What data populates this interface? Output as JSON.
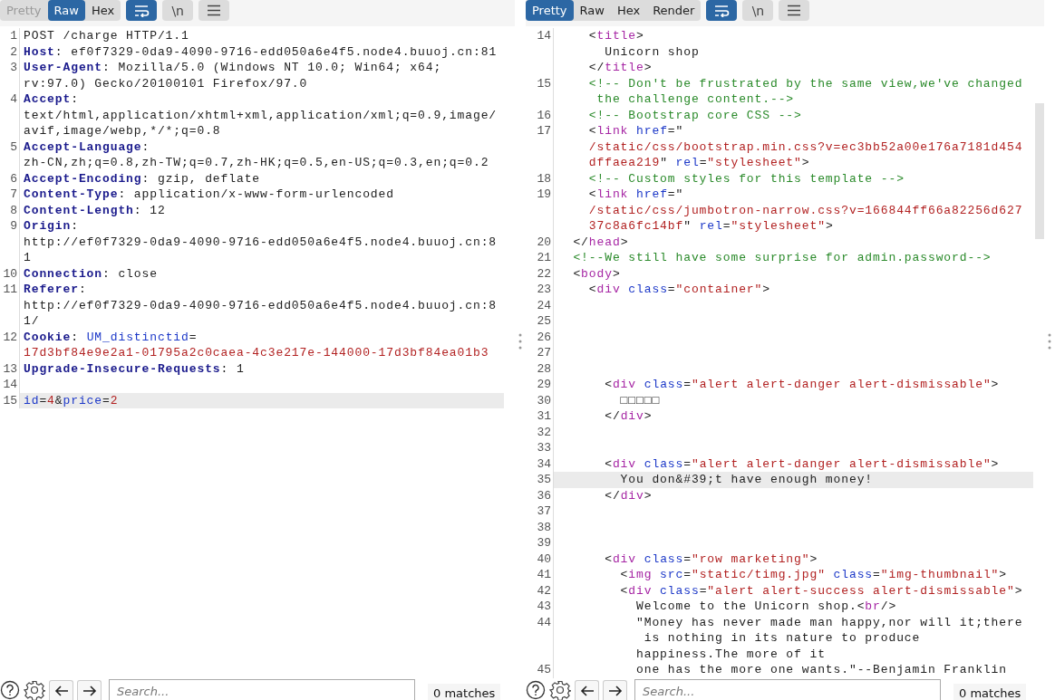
{
  "panes": [
    {
      "view_tabs": [
        {
          "label": "Pretty",
          "selected": false,
          "disabled": true
        },
        {
          "label": "Raw",
          "selected": true,
          "disabled": false
        },
        {
          "label": "Hex",
          "selected": false,
          "disabled": false
        }
      ],
      "tools": [
        {
          "kind": "wrap",
          "on": true
        },
        {
          "kind": "newline",
          "label": "\\n",
          "on": false
        },
        {
          "kind": "menu",
          "on": false
        }
      ],
      "scrollable": false,
      "lines": [
        {
          "no": "1",
          "current": false,
          "rows": [
            {
              "spans": [
                {
                  "kind": "p",
                  "text": "POST /charge HTTP/1.1"
                }
              ]
            }
          ]
        },
        {
          "no": "2",
          "current": false,
          "rows": [
            {
              "spans": [
                {
                  "kind": "h",
                  "text": "Host"
                },
                {
                  "kind": "p",
                  "text": ": ef0f7329-0da9-4090-9716-edd050a6e4f5.node4.buuoj.cn:81"
                }
              ]
            }
          ]
        },
        {
          "no": "3",
          "current": false,
          "rows": [
            {
              "spans": [
                {
                  "kind": "h",
                  "text": "User-Agent"
                },
                {
                  "kind": "p",
                  "text": ": Mozilla/5.0 (Windows NT 10.0; Win64; x64;"
                }
              ]
            },
            {
              "spans": [
                {
                  "kind": "p",
                  "text": "rv:97.0) Gecko/20100101 Firefox/97.0"
                }
              ]
            }
          ]
        },
        {
          "no": "4",
          "current": false,
          "rows": [
            {
              "spans": [
                {
                  "kind": "h",
                  "text": "Accept"
                },
                {
                  "kind": "p",
                  "text": ":"
                }
              ]
            },
            {
              "spans": [
                {
                  "kind": "p",
                  "text": "text/html,application/xhtml+xml,application/xml;q=0.9,image/"
                }
              ]
            },
            {
              "spans": [
                {
                  "kind": "p",
                  "text": "avif,image/webp,*/*;q=0.8"
                }
              ]
            }
          ]
        },
        {
          "no": "5",
          "current": false,
          "rows": [
            {
              "spans": [
                {
                  "kind": "h",
                  "text": "Accept-Language"
                },
                {
                  "kind": "p",
                  "text": ":"
                }
              ]
            },
            {
              "spans": [
                {
                  "kind": "p",
                  "text": "zh-CN,zh;q=0.8,zh-TW;q=0.7,zh-HK;q=0.5,en-US;q=0.3,en;q=0.2"
                }
              ]
            }
          ]
        },
        {
          "no": "6",
          "current": false,
          "rows": [
            {
              "spans": [
                {
                  "kind": "h",
                  "text": "Accept-Encoding"
                },
                {
                  "kind": "p",
                  "text": ": gzip, deflate"
                }
              ]
            }
          ]
        },
        {
          "no": "7",
          "current": false,
          "rows": [
            {
              "spans": [
                {
                  "kind": "h",
                  "text": "Content-Type"
                },
                {
                  "kind": "p",
                  "text": ": application/x-www-form-urlencoded"
                }
              ]
            }
          ]
        },
        {
          "no": "8",
          "current": false,
          "rows": [
            {
              "spans": [
                {
                  "kind": "h",
                  "text": "Content-Length"
                },
                {
                  "kind": "p",
                  "text": ": 12"
                }
              ]
            }
          ]
        },
        {
          "no": "9",
          "current": false,
          "rows": [
            {
              "spans": [
                {
                  "kind": "h",
                  "text": "Origin"
                },
                {
                  "kind": "p",
                  "text": ":"
                }
              ]
            },
            {
              "spans": [
                {
                  "kind": "p",
                  "text": "http://ef0f7329-0da9-4090-9716-edd050a6e4f5.node4.buuoj.cn:8"
                }
              ]
            },
            {
              "spans": [
                {
                  "kind": "p",
                  "text": "1"
                }
              ]
            }
          ]
        },
        {
          "no": "10",
          "current": false,
          "rows": [
            {
              "spans": [
                {
                  "kind": "h",
                  "text": "Connection"
                },
                {
                  "kind": "p",
                  "text": ": close"
                }
              ]
            }
          ]
        },
        {
          "no": "11",
          "current": false,
          "rows": [
            {
              "spans": [
                {
                  "kind": "h",
                  "text": "Referer"
                },
                {
                  "kind": "p",
                  "text": ":"
                }
              ]
            },
            {
              "spans": [
                {
                  "kind": "p",
                  "text": "http://ef0f7329-0da9-4090-9716-edd050a6e4f5.node4.buuoj.cn:8"
                }
              ]
            },
            {
              "spans": [
                {
                  "kind": "p",
                  "text": "1/"
                }
              ]
            }
          ]
        },
        {
          "no": "12",
          "current": false,
          "rows": [
            {
              "spans": [
                {
                  "kind": "h",
                  "text": "Cookie"
                },
                {
                  "kind": "p",
                  "text": ": "
                },
                {
                  "kind": "a",
                  "text": "UM_distinctid"
                },
                {
                  "kind": "p",
                  "text": "="
                }
              ]
            },
            {
              "spans": [
                {
                  "kind": "v",
                  "text": "17d3bf84e9e2a1-01795a2c0caea-4c3e217e-144000-17d3bf84ea01b3"
                }
              ]
            }
          ]
        },
        {
          "no": "13",
          "current": false,
          "rows": [
            {
              "spans": [
                {
                  "kind": "h",
                  "text": "Upgrade-Insecure-Requests"
                },
                {
                  "kind": "p",
                  "text": ": 1"
                }
              ]
            }
          ]
        },
        {
          "no": "14",
          "current": false
        },
        {
          "no": "15",
          "current": true,
          "rows": [
            {
              "spans": [
                {
                  "kind": "a",
                  "text": "id"
                },
                {
                  "kind": "p",
                  "text": "="
                },
                {
                  "kind": "v",
                  "text": "4"
                },
                {
                  "kind": "p",
                  "text": "&"
                },
                {
                  "kind": "a",
                  "text": "price"
                },
                {
                  "kind": "p",
                  "text": "="
                },
                {
                  "kind": "v",
                  "text": "2"
                }
              ]
            }
          ]
        }
      ],
      "search": {
        "placeholder": "Search...",
        "matches": "0 matches"
      }
    },
    {
      "view_tabs": [
        {
          "label": "Pretty",
          "selected": true,
          "disabled": false
        },
        {
          "label": "Raw",
          "selected": false,
          "disabled": false
        },
        {
          "label": "Hex",
          "selected": false,
          "disabled": false
        },
        {
          "label": "Render",
          "selected": false,
          "disabled": false
        }
      ],
      "tools": [
        {
          "kind": "wrap",
          "on": true
        },
        {
          "kind": "newline",
          "label": "\\n",
          "on": false
        },
        {
          "kind": "menu",
          "on": false
        }
      ],
      "scrollable": true,
      "lines": [
        {
          "no": "14",
          "current": false,
          "rows": [
            {
              "spans": [
                {
                  "kind": "p",
                  "text": "    <"
                },
                {
                  "kind": "tag",
                  "text": "title"
                },
                {
                  "kind": "p",
                  "text": ">"
                }
              ]
            },
            {
              "spans": [
                {
                  "kind": "p",
                  "text": "      Unicorn shop"
                }
              ]
            },
            {
              "spans": [
                {
                  "kind": "p",
                  "text": "    </"
                },
                {
                  "kind": "tag",
                  "text": "title"
                },
                {
                  "kind": "p",
                  "text": ">"
                }
              ]
            }
          ]
        },
        {
          "no": "15",
          "current": false,
          "rows": [
            {
              "spans": [
                {
                  "kind": "c",
                  "text": "    <!-- Don't be frustrated by the same view,we've changed"
                }
              ]
            },
            {
              "spans": [
                {
                  "kind": "c",
                  "text": "     the challenge content.-->"
                }
              ]
            }
          ]
        },
        {
          "no": "16",
          "current": false,
          "rows": [
            {
              "spans": [
                {
                  "kind": "c",
                  "text": "    <!-- Bootstrap core CSS -->"
                }
              ]
            }
          ]
        },
        {
          "no": "17",
          "current": false,
          "rows": [
            {
              "spans": [
                {
                  "kind": "p",
                  "text": "    <"
                },
                {
                  "kind": "tag",
                  "text": "link"
                },
                {
                  "kind": "a",
                  "text": " href"
                },
                {
                  "kind": "p",
                  "text": "=\""
                }
              ]
            },
            {
              "spans": [
                {
                  "kind": "s",
                  "text": "    /static/css/bootstrap.min.css?v=ec3bb52a00e176a7181d454"
                }
              ]
            },
            {
              "spans": [
                {
                  "kind": "s",
                  "text": "    dffaea219"
                },
                {
                  "kind": "p",
                  "text": "\" "
                },
                {
                  "kind": "a",
                  "text": "rel"
                },
                {
                  "kind": "p",
                  "text": "="
                },
                {
                  "kind": "s",
                  "text": "\"stylesheet\""
                },
                {
                  "kind": "p",
                  "text": ">"
                }
              ]
            }
          ]
        },
        {
          "no": "18",
          "current": false,
          "rows": [
            {
              "spans": [
                {
                  "kind": "c",
                  "text": "    <!-- Custom styles for this template -->"
                }
              ]
            }
          ]
        },
        {
          "no": "19",
          "current": false,
          "rows": [
            {
              "spans": [
                {
                  "kind": "p",
                  "text": "    <"
                },
                {
                  "kind": "tag",
                  "text": "link"
                },
                {
                  "kind": "a",
                  "text": " href"
                },
                {
                  "kind": "p",
                  "text": "=\""
                }
              ]
            },
            {
              "spans": [
                {
                  "kind": "s",
                  "text": "    /static/css/jumbotron-narrow.css?v=166844ff66a82256d627"
                }
              ]
            },
            {
              "spans": [
                {
                  "kind": "s",
                  "text": "    37c8a6fc14bf"
                },
                {
                  "kind": "p",
                  "text": "\" "
                },
                {
                  "kind": "a",
                  "text": "rel"
                },
                {
                  "kind": "p",
                  "text": "="
                },
                {
                  "kind": "s",
                  "text": "\"stylesheet\""
                },
                {
                  "kind": "p",
                  "text": ">"
                }
              ]
            }
          ]
        },
        {
          "no": "20",
          "current": false,
          "rows": [
            {
              "spans": [
                {
                  "kind": "p",
                  "text": "  </"
                },
                {
                  "kind": "tag",
                  "text": "head"
                },
                {
                  "kind": "p",
                  "text": ">"
                }
              ]
            }
          ]
        },
        {
          "no": "21",
          "current": false,
          "rows": [
            {
              "spans": [
                {
                  "kind": "c",
                  "text": "  <!--We still have some surprise for admin.password-->"
                }
              ]
            }
          ]
        },
        {
          "no": "22",
          "current": false,
          "rows": [
            {
              "spans": [
                {
                  "kind": "p",
                  "text": "  <"
                },
                {
                  "kind": "tag",
                  "text": "body"
                },
                {
                  "kind": "p",
                  "text": ">"
                }
              ]
            }
          ]
        },
        {
          "no": "23",
          "current": false,
          "rows": [
            {
              "spans": [
                {
                  "kind": "p",
                  "text": "    <"
                },
                {
                  "kind": "tag",
                  "text": "div"
                },
                {
                  "kind": "a",
                  "text": " class"
                },
                {
                  "kind": "p",
                  "text": "="
                },
                {
                  "kind": "s",
                  "text": "\"container\""
                },
                {
                  "kind": "p",
                  "text": ">"
                }
              ]
            }
          ]
        },
        {
          "no": "24",
          "current": false
        },
        {
          "no": "25",
          "current": false
        },
        {
          "no": "26",
          "current": false
        },
        {
          "no": "27",
          "current": false
        },
        {
          "no": "28",
          "current": false
        },
        {
          "no": "29",
          "current": false,
          "rows": [
            {
              "spans": [
                {
                  "kind": "p",
                  "text": "      <"
                },
                {
                  "kind": "tag",
                  "text": "div"
                },
                {
                  "kind": "a",
                  "text": " class"
                },
                {
                  "kind": "p",
                  "text": "="
                },
                {
                  "kind": "s",
                  "text": "\"alert alert-danger alert-dismissable\""
                },
                {
                  "kind": "p",
                  "text": ">"
                }
              ]
            }
          ]
        },
        {
          "no": "30",
          "current": false,
          "rows": [
            {
              "spans": [
                {
                  "kind": "p",
                  "text": "        □□□□□"
                }
              ]
            }
          ]
        },
        {
          "no": "31",
          "current": false,
          "rows": [
            {
              "spans": [
                {
                  "kind": "p",
                  "text": "      </"
                },
                {
                  "kind": "tag",
                  "text": "div"
                },
                {
                  "kind": "p",
                  "text": ">"
                }
              ]
            }
          ]
        },
        {
          "no": "32",
          "current": false
        },
        {
          "no": "33",
          "current": false
        },
        {
          "no": "34",
          "current": false,
          "rows": [
            {
              "spans": [
                {
                  "kind": "p",
                  "text": "      <"
                },
                {
                  "kind": "tag",
                  "text": "div"
                },
                {
                  "kind": "a",
                  "text": " class"
                },
                {
                  "kind": "p",
                  "text": "="
                },
                {
                  "kind": "s",
                  "text": "\"alert alert-danger alert-dismissable\""
                },
                {
                  "kind": "p",
                  "text": ">"
                }
              ]
            }
          ]
        },
        {
          "no": "35",
          "current": true,
          "rows": [
            {
              "spans": [
                {
                  "kind": "p",
                  "text": "        You don&#39;t have enough money!"
                }
              ]
            }
          ]
        },
        {
          "no": "36",
          "current": false,
          "rows": [
            {
              "spans": [
                {
                  "kind": "p",
                  "text": "      </"
                },
                {
                  "kind": "tag",
                  "text": "div"
                },
                {
                  "kind": "p",
                  "text": ">"
                }
              ]
            }
          ]
        },
        {
          "no": "37",
          "current": false
        },
        {
          "no": "38",
          "current": false
        },
        {
          "no": "39",
          "current": false
        },
        {
          "no": "40",
          "current": false,
          "rows": [
            {
              "spans": [
                {
                  "kind": "p",
                  "text": "      <"
                },
                {
                  "kind": "tag",
                  "text": "div"
                },
                {
                  "kind": "a",
                  "text": " class"
                },
                {
                  "kind": "p",
                  "text": "="
                },
                {
                  "kind": "s",
                  "text": "\"row marketing\""
                },
                {
                  "kind": "p",
                  "text": ">"
                }
              ]
            }
          ]
        },
        {
          "no": "41",
          "current": false,
          "rows": [
            {
              "spans": [
                {
                  "kind": "p",
                  "text": "        <"
                },
                {
                  "kind": "tag",
                  "text": "img"
                },
                {
                  "kind": "a",
                  "text": " src"
                },
                {
                  "kind": "p",
                  "text": "="
                },
                {
                  "kind": "s",
                  "text": "\"static/timg.jpg\""
                },
                {
                  "kind": "a",
                  "text": " class"
                },
                {
                  "kind": "p",
                  "text": "="
                },
                {
                  "kind": "s",
                  "text": "\"img-thumbnail\""
                },
                {
                  "kind": "p",
                  "text": ">"
                }
              ]
            }
          ]
        },
        {
          "no": "42",
          "current": false,
          "rows": [
            {
              "spans": [
                {
                  "kind": "p",
                  "text": "        <"
                },
                {
                  "kind": "tag",
                  "text": "div"
                },
                {
                  "kind": "a",
                  "text": " class"
                },
                {
                  "kind": "p",
                  "text": "="
                },
                {
                  "kind": "s",
                  "text": "\"alert alert-success alert-dismissable\""
                },
                {
                  "kind": "p",
                  "text": ">"
                }
              ]
            }
          ]
        },
        {
          "no": "43",
          "current": false,
          "rows": [
            {
              "spans": [
                {
                  "kind": "p",
                  "text": "          Welcome to the Unicorn shop.<"
                },
                {
                  "kind": "tag",
                  "text": "br"
                },
                {
                  "kind": "p",
                  "text": "/>"
                }
              ]
            }
          ]
        },
        {
          "no": "44",
          "current": false,
          "rows": [
            {
              "spans": [
                {
                  "kind": "p",
                  "text": "          \"Money has never made man happy,nor will it;there"
                }
              ]
            },
            {
              "spans": [
                {
                  "kind": "p",
                  "text": "           is nothing in its nature to produce"
                }
              ]
            },
            {
              "spans": [
                {
                  "kind": "p",
                  "text": "          happiness.The more of it"
                }
              ]
            }
          ]
        },
        {
          "no": "45",
          "current": false,
          "rows": [
            {
              "spans": [
                {
                  "kind": "p",
                  "text": "          one has the more one wants.\"--Benjamin Franklin"
                }
              ]
            }
          ]
        }
      ],
      "search": {
        "placeholder": "Search...",
        "matches": "0 matches"
      }
    }
  ]
}
